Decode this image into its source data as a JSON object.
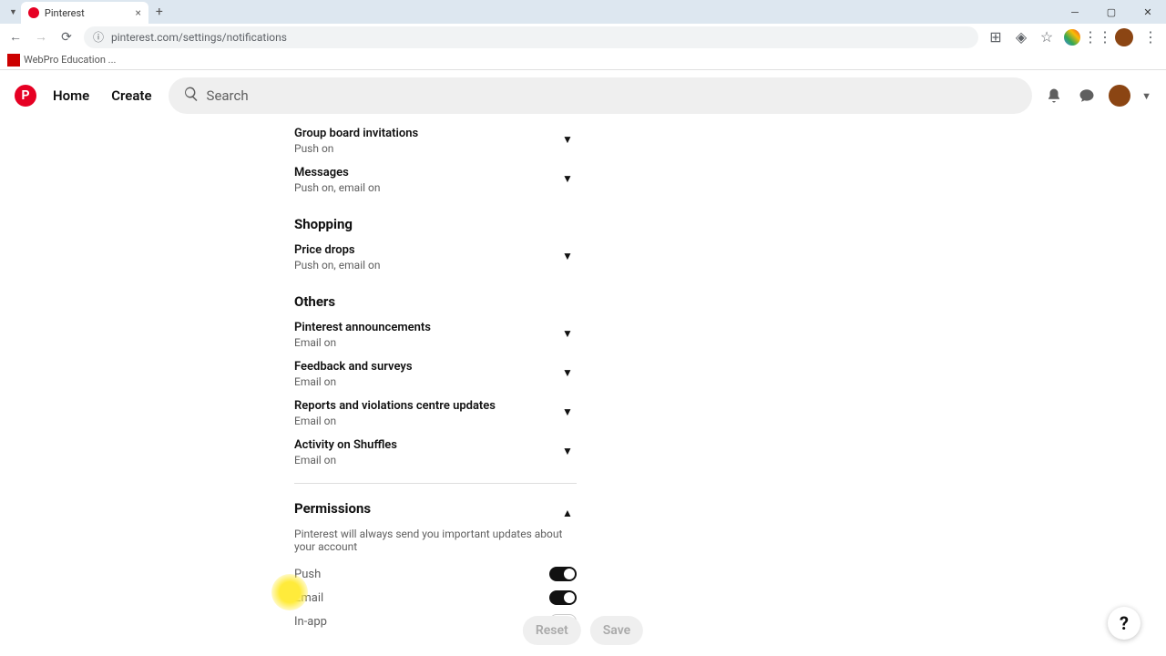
{
  "browser": {
    "tab_title": "Pinterest",
    "url": "pinterest.com/settings/notifications",
    "bookmark": "WebPro Education ..."
  },
  "header": {
    "home": "Home",
    "create": "Create",
    "search_placeholder": "Search"
  },
  "settings": {
    "items": [
      {
        "title": "Group board invitations",
        "status": "Push on"
      },
      {
        "title": "Messages",
        "status": "Push on, email on"
      }
    ],
    "shopping": {
      "label": "Shopping",
      "items": [
        {
          "title": "Price drops",
          "status": "Push on, email on"
        }
      ]
    },
    "others": {
      "label": "Others",
      "items": [
        {
          "title": "Pinterest announcements",
          "status": "Email on"
        },
        {
          "title": "Feedback and surveys",
          "status": "Email on"
        },
        {
          "title": "Reports and violations centre updates",
          "status": "Email on"
        },
        {
          "title": "Activity on Shuffles",
          "status": "Email on"
        }
      ]
    },
    "permissions": {
      "label": "Permissions",
      "desc": "Pinterest will always send you important updates about your account",
      "toggles": [
        {
          "label": "Push",
          "on": true
        },
        {
          "label": "Email",
          "on": true
        },
        {
          "label": "In-app",
          "on": false
        }
      ]
    }
  },
  "footer": {
    "reset": "Reset",
    "save": "Save"
  },
  "help": "?"
}
